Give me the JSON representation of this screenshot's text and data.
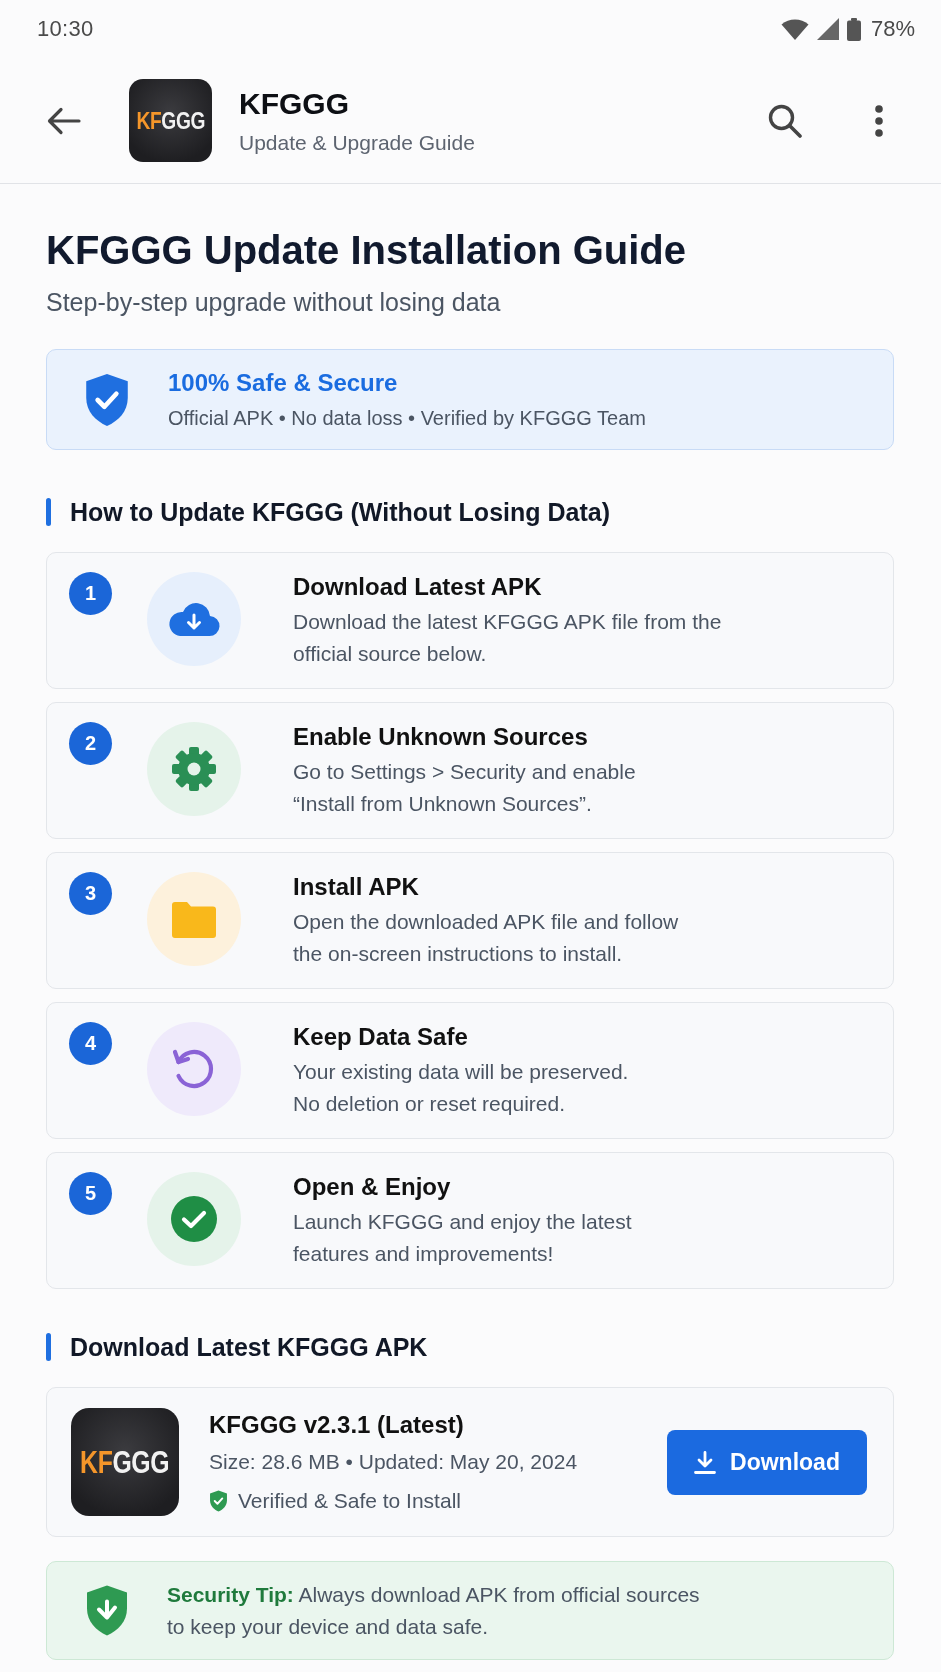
{
  "status_bar": {
    "time": "10:30",
    "battery": "78%"
  },
  "app_bar": {
    "logo": {
      "accent": "KF",
      "text": "GGG"
    },
    "title": "KFGGG",
    "subtitle": "Update & Upgrade Guide"
  },
  "header": {
    "title": "KFGGG Update Installation Guide",
    "subtitle": "Step-by-step upgrade without losing data"
  },
  "safety_banner": {
    "title": "100% Safe & Secure",
    "details": "Official APK • No data loss • Verified by KFGGG Team"
  },
  "update_steps": {
    "heading": "How to Update KFGGG (Without Losing Data)",
    "steps": [
      {
        "number": "1",
        "kind": "download",
        "title": "Download Latest APK",
        "description": "Download the latest KFGGG APK file from the\nofficial source below."
      },
      {
        "number": "2",
        "kind": "settings",
        "title": "Enable Unknown Sources",
        "description": "Go to Settings > Security and enable\n“Install from Unknown Sources”."
      },
      {
        "number": "3",
        "kind": "folder",
        "title": "Install APK",
        "description": "Open the downloaded APK file and follow\nthe on-screen instructions to install."
      },
      {
        "number": "4",
        "kind": "restore",
        "title": "Keep Data Safe",
        "description": "Your existing data will be preserved.\nNo deletion or reset required."
      },
      {
        "number": "5",
        "kind": "done",
        "title": "Open & Enjoy",
        "description": "Launch KFGGG and enjoy the latest\nfeatures and improvements!"
      }
    ]
  },
  "download": {
    "heading": "Download Latest KFGGG APK",
    "app": {
      "logo": {
        "accent": "KF",
        "text": "GGG"
      },
      "name": "KFGGG v2.3.1 (Latest)",
      "info": "Size: 28.6 MB • Updated: May 20, 2024",
      "verified": "Verified & Safe to Install"
    },
    "button": "Download"
  },
  "security_tip": {
    "text": "**Security Tip:** Always download APK from official sources\nto keep your device and data safe."
  }
}
